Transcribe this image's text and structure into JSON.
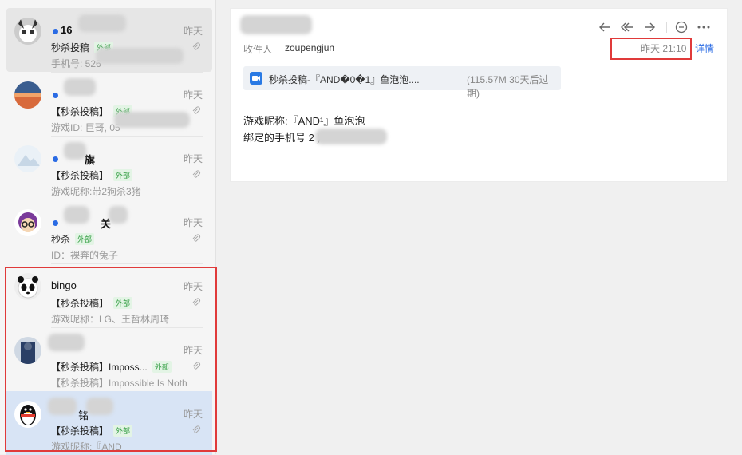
{
  "messages": [
    {
      "sender": "16",
      "time": "昨天",
      "subject": "秒杀投稿",
      "badge": "外部",
      "preview": "手机号: 526",
      "unread": true
    },
    {
      "sender": "",
      "time": "昨天",
      "subject": "【秒杀投稿】",
      "badge": "外部",
      "preview": "游戏ID: 巨哥, 05",
      "unread": true
    },
    {
      "sender": "旗",
      "time": "昨天",
      "subject": "【秒杀投稿】",
      "badge": "外部",
      "preview": "游戏昵称:带2狗杀3猪",
      "unread": true
    },
    {
      "sender": "关",
      "time": "昨天",
      "subject": "秒杀",
      "badge": "外部",
      "preview": "ID：裸奔的兔子",
      "unread": true
    },
    {
      "sender": "bingo",
      "time": "昨天",
      "subject": "【秒杀投稿】",
      "badge": "外部",
      "preview": "游戏昵称：LG、王哲林周琦",
      "unread": false
    },
    {
      "sender": "",
      "time": "昨天",
      "subject": "【秒杀投稿】Imposs...",
      "badge": "外部",
      "preview": "【秒杀投稿】Impossible Is Noth",
      "unread": false
    },
    {
      "sender": "铭",
      "time": "昨天",
      "subject": "【秒杀投稿】",
      "badge": "外部",
      "preview": "游戏昵称:『AND",
      "unread": false
    }
  ],
  "detail": {
    "recipient_label": "收件人",
    "recipient": "zoupengjun",
    "datetime": "昨天 21:10",
    "details_link": "详情",
    "attachment": {
      "name": "秒杀投稿-『AND�0�1』鱼泡泡....",
      "meta": "(115.57M  30天后过期)"
    },
    "body_line1": "游戏昵称:『AND¹』鱼泡泡",
    "body_line2": "绑定的手机号          2     )"
  },
  "icons": [
    "reply-icon",
    "reply-all-icon",
    "forward-icon",
    "comment-icon",
    "more-icon",
    "attachment-clip-icon",
    "video-file-icon"
  ],
  "colors": {
    "accent": "#2a6be4",
    "highlight_box": "#e03a3a",
    "selected_bg": "#d8e4f5",
    "badge_text": "#2e9b3e"
  }
}
